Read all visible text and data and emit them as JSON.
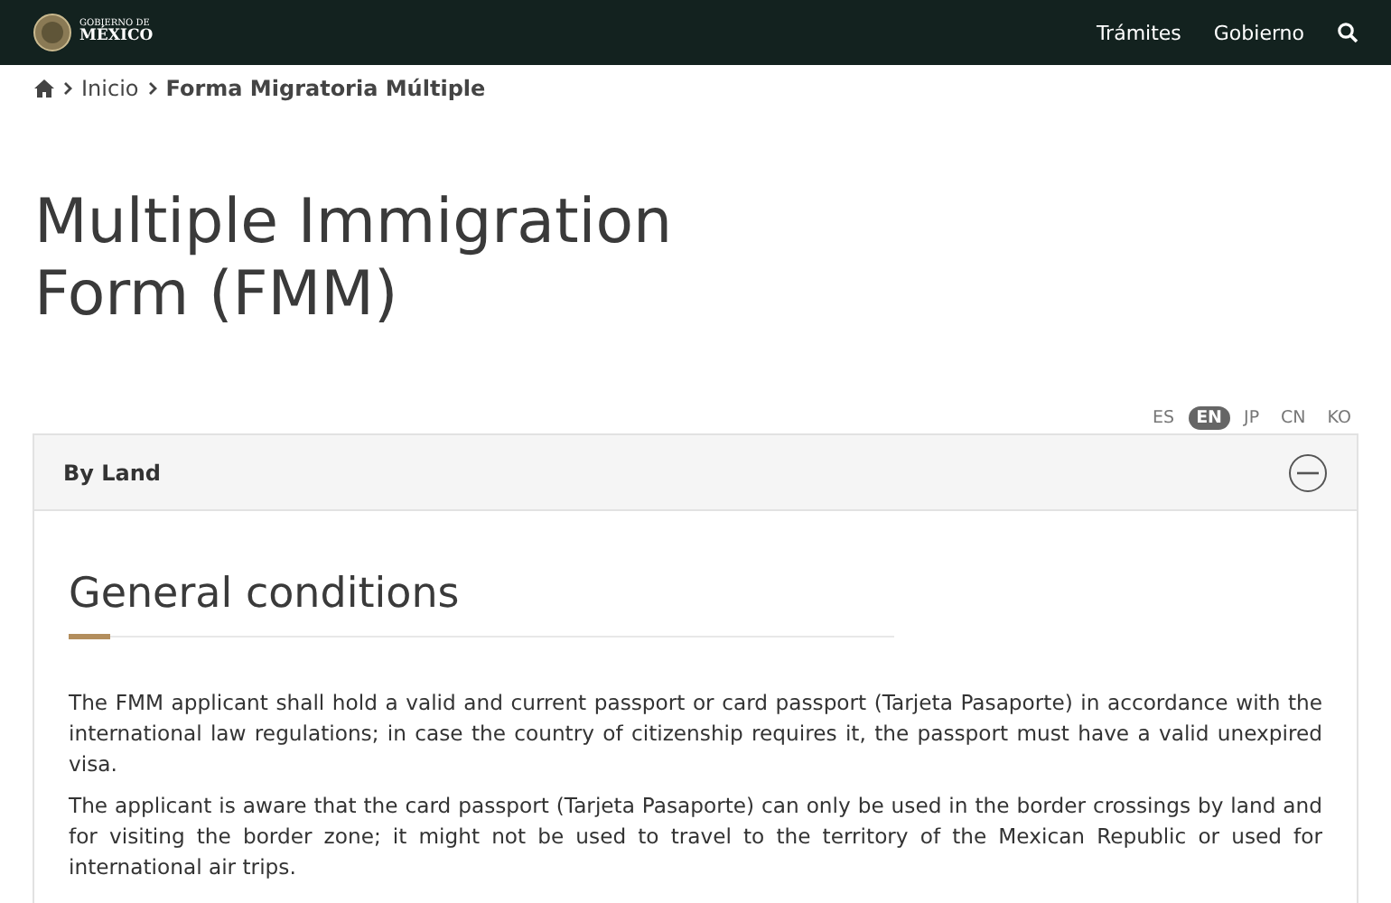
{
  "header": {
    "logo_small": "GOBIERNO DE",
    "logo_big": "MÉXICO",
    "nav": [
      "Trámites",
      "Gobierno"
    ]
  },
  "breadcrumb": [
    {
      "label": "Inicio",
      "current": false
    },
    {
      "label": "Forma Migratoria Múltiple",
      "current": true
    }
  ],
  "title": "Multiple Immigration Form (FMM)",
  "languages": [
    {
      "label": "ES",
      "selected": false
    },
    {
      "label": "EN",
      "selected": true
    },
    {
      "label": "JP",
      "selected": false
    },
    {
      "label": "CN",
      "selected": false
    },
    {
      "label": "KO",
      "selected": false
    }
  ],
  "accordion": {
    "title": "By Land",
    "expanded": true,
    "heading": "General conditions",
    "paragraphs": [
      "The FMM applicant shall hold a valid and current passport or card passport (Tarjeta Pasaporte) in accordance with the international law regulations; in case the country of citizenship requires it, the passport must have a valid unexpired visa.",
      "The applicant is aware that the card passport (Tarjeta Pasaporte) can only be used in the border crossings by land and for visiting the border zone; it might not be used to travel to the territory of the Mexican Republic or used for international air trips."
    ]
  }
}
